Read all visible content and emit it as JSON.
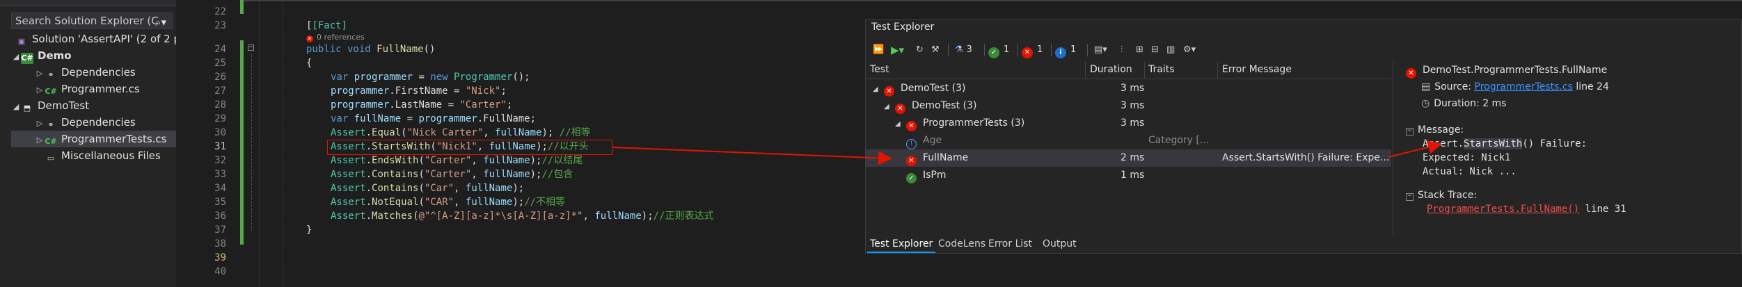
{
  "solution_explorer": {
    "search_placeholder": "Search Solution Explorer (C",
    "items": [
      {
        "label": "Solution 'AssertAPI' (2 of 2 p"
      },
      {
        "label": "Demo"
      },
      {
        "label": "Dependencies"
      },
      {
        "label": "Programmer.cs"
      },
      {
        "label": "DemoTest"
      },
      {
        "label": "Dependencies"
      },
      {
        "label": "ProgrammerTests.cs"
      },
      {
        "label": "Miscellaneous Files"
      }
    ]
  },
  "editor": {
    "line_numbers": [
      "22",
      "23",
      "",
      "24",
      "25",
      "26",
      "27",
      "28",
      "29",
      "30",
      "31",
      "32",
      "33",
      "34",
      "35",
      "36",
      "37",
      "38",
      "39",
      "40"
    ],
    "references": "0 references",
    "lines": {
      "l23": "[Fact]",
      "l24_kw": "public void ",
      "l24_name": "FullName",
      "l24_rest": "()",
      "l25": "{",
      "l26_a": "var ",
      "l26_b": "programmer",
      "l26_c": " = ",
      "l26_d": "new ",
      "l26_e": "Programmer",
      "l26_f": "();",
      "l27_a": "programmer",
      "l27_b": ".FirstName = ",
      "l27_c": "\"Nick\"",
      "l27_d": ";",
      "l28_a": "programmer",
      "l28_b": ".LastName = ",
      "l28_c": "\"Carter\"",
      "l28_d": ";",
      "l29_a": "var ",
      "l29_b": "fullName",
      "l29_c": " = ",
      "l29_d": "programmer",
      "l29_e": ".FullName;",
      "l30_a": "Assert",
      "l30_b": ".",
      "l30_c": "Equal",
      "l30_d": "(",
      "l30_e": "\"Nick Carter\"",
      "l30_f": ", ",
      "l30_g": "fullName",
      "l30_h": "); ",
      "l30_i": "//相等",
      "l31_a": "Assert",
      "l31_b": ".",
      "l31_c": "StartsWith",
      "l31_d": "(",
      "l31_e": "\"Nick1\"",
      "l31_f": ", ",
      "l31_g": "fullName",
      "l31_h": ");",
      "l31_i": "//以开头",
      "l32_a": "Assert",
      "l32_b": ".",
      "l32_c": "EndsWith",
      "l32_d": "(",
      "l32_e": "\"Carter\"",
      "l32_f": ", ",
      "l32_g": "fullName",
      "l32_h": ");",
      "l32_i": "//以结尾",
      "l33_a": "Assert",
      "l33_b": ".",
      "l33_c": "Contains",
      "l33_d": "(",
      "l33_e": "\"Carter\"",
      "l33_f": ", ",
      "l33_g": "fullName",
      "l33_h": ");",
      "l33_i": "//包含",
      "l34_a": "Assert",
      "l34_b": ".",
      "l34_c": "Contains",
      "l34_d": "(",
      "l34_e": "\"Car\"",
      "l34_f": ", ",
      "l34_g": "fullName",
      "l34_h": ");",
      "l35_a": "Assert",
      "l35_b": ".",
      "l35_c": "NotEqual",
      "l35_d": "(",
      "l35_e": "\"CAR\"",
      "l35_f": ", ",
      "l35_g": "fullName",
      "l35_h": ");",
      "l35_i": "//不相等",
      "l36_a": "Assert",
      "l36_b": ".",
      "l36_c": "Matches",
      "l36_d": "(",
      "l36_e": "@\"^[A-Z][a-z]*\\s[A-Z][a-z]*\"",
      "l36_f": ", ",
      "l36_g": "fullName",
      "l36_h": ");",
      "l36_i": "//正则表达式",
      "l37": "}"
    }
  },
  "test_explorer": {
    "title": "Test Explorer",
    "counts": {
      "total": "3",
      "passed": "1",
      "failed": "1",
      "info": "1"
    },
    "columns": [
      "Test",
      "Duration",
      "Traits",
      "Error Message"
    ],
    "rows": [
      {
        "name": "DemoTest (3)",
        "duration": "3 ms",
        "traits": "",
        "error": ""
      },
      {
        "name": "DemoTest (3)",
        "duration": "3 ms",
        "traits": "",
        "error": ""
      },
      {
        "name": "ProgrammerTests (3)",
        "duration": "3 ms",
        "traits": "",
        "error": ""
      },
      {
        "name": "Age",
        "duration": "",
        "traits": "Category [...",
        "error": ""
      },
      {
        "name": "FullName",
        "duration": "2 ms",
        "traits": "",
        "error": "Assert.StartsWith() Failure: Expe..."
      },
      {
        "name": "IsPm",
        "duration": "1 ms",
        "traits": "",
        "error": ""
      }
    ],
    "tabs": [
      "Test Explorer",
      "CodeLens",
      "Error List",
      "Output"
    ],
    "detail": {
      "title": "DemoTest.ProgrammerTests.FullName",
      "source_label": "Source: ",
      "source_link": "ProgrammerTests.cs",
      "source_line": " line 24",
      "duration": "Duration: 2 ms",
      "message_label": "Message:",
      "msg1_a": "Assert.",
      "msg1_b": "StartsWith",
      "msg1_c": "() Failure:",
      "msg2": "Expected: Nick1",
      "msg3": "Actual:   Nick ...",
      "stack_label": "Stack Trace:",
      "stack_link": "ProgrammerTests.FullName()",
      "stack_line": " line 31"
    }
  },
  "colors": {
    "fail": "#e51400",
    "pass": "#388a34",
    "accent": "#0e97f5",
    "arrow": "#e51400"
  }
}
